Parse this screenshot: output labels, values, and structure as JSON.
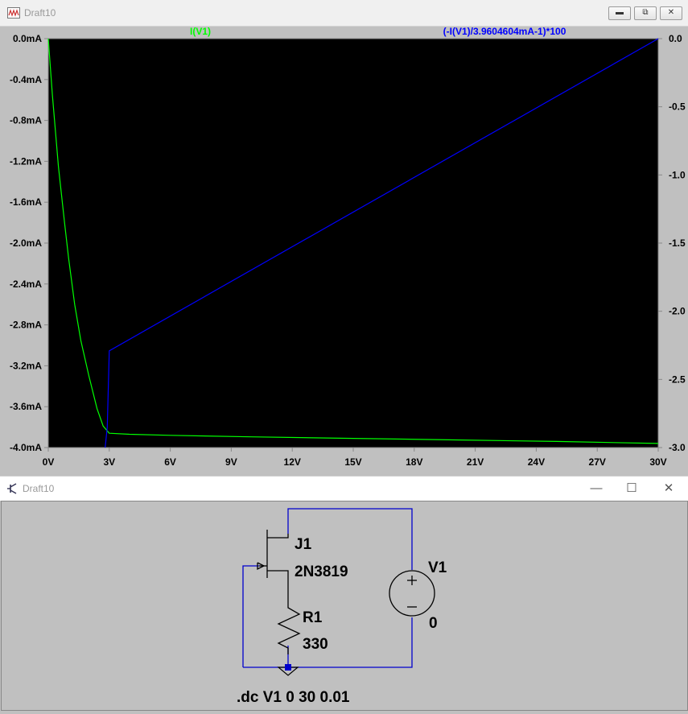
{
  "plot_window": {
    "title": "Draft10",
    "buttons": {
      "minimize": "▬",
      "restore": "⧉",
      "close": "✕"
    }
  },
  "schematic_window": {
    "title": "Draft10",
    "buttons": {
      "minimize": "—",
      "maximize": "☐",
      "close": "✕"
    }
  },
  "chart_data": {
    "type": "line",
    "background": "#000000",
    "xlim": [
      0,
      30
    ],
    "x_ticks": [
      "0V",
      "3V",
      "6V",
      "9V",
      "12V",
      "15V",
      "18V",
      "21V",
      "24V",
      "27V",
      "30V"
    ],
    "left_axis": {
      "ylim": [
        -4.0,
        0.0
      ],
      "tick_labels": [
        "0.0mA",
        "-0.4mA",
        "-0.8mA",
        "-1.2mA",
        "-1.6mA",
        "-2.0mA",
        "-2.4mA",
        "-2.8mA",
        "-3.2mA",
        "-3.6mA",
        "-4.0mA"
      ]
    },
    "right_axis": {
      "ylim": [
        -3.0,
        0.0
      ],
      "tick_labels": [
        "0.0",
        "-0.5",
        "-1.0",
        "-1.5",
        "-2.0",
        "-2.5",
        "-3.0"
      ]
    },
    "grid": false,
    "series": [
      {
        "name": "I(V1)",
        "axis": "left",
        "color": "#00ff00",
        "x": [
          0,
          0.2,
          0.5,
          0.8,
          1.0,
          1.3,
          1.6,
          2.0,
          2.4,
          2.7,
          3.0,
          4.0,
          6.0,
          10.0,
          15.0,
          20.0,
          25.0,
          30.0
        ],
        "y": [
          0.0,
          -0.55,
          -1.25,
          -1.8,
          -2.15,
          -2.6,
          -2.95,
          -3.3,
          -3.62,
          -3.79,
          -3.86,
          -3.87,
          -3.88,
          -3.895,
          -3.91,
          -3.925,
          -3.94,
          -3.96
        ]
      },
      {
        "name": "(-I(V1)/3.9604604mA-1)*100",
        "axis": "right",
        "color": "#0000ff",
        "x": [
          2.8,
          2.9,
          3.0,
          30.0
        ],
        "y": [
          -3.0,
          -2.85,
          -2.29,
          0.0
        ]
      }
    ]
  },
  "schematic": {
    "jfet_ref": "J1",
    "jfet_model": "2N3819",
    "resistor_ref": "R1",
    "resistor_value": "330",
    "source_ref": "V1",
    "source_value": "0",
    "directive": ".dc V1 0 30 0.01",
    "wire_color": "#0000cc"
  }
}
